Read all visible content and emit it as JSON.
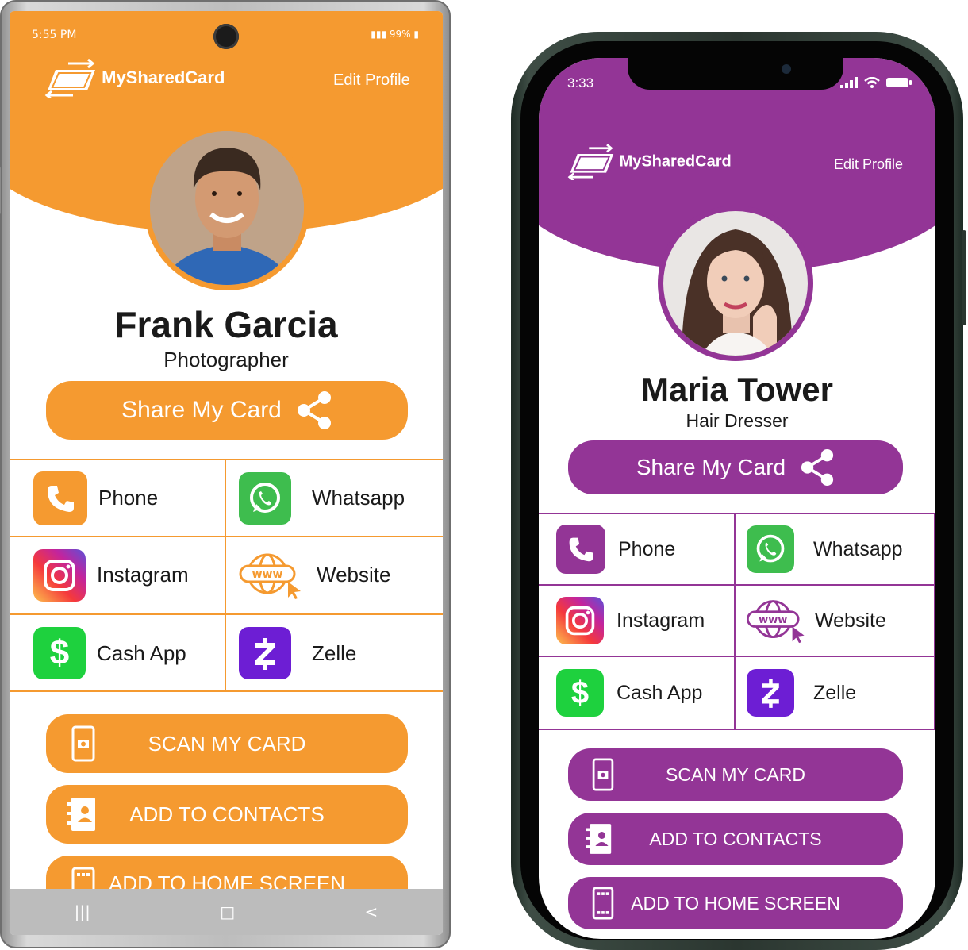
{
  "colors": {
    "android_accent": "#f59a30",
    "iphone_accent": "#933596",
    "whatsapp": "#3ebd4e",
    "cashapp": "#1ed13e",
    "zelle": "#6d1ed4"
  },
  "android": {
    "status": {
      "time": "5:55 PM",
      "battery": "99%"
    },
    "brand": "MySharedCard",
    "edit_profile": "Edit Profile",
    "name": "Frank Garcia",
    "title": "Photographer",
    "share_label": "Share My Card",
    "links": [
      {
        "label": "Phone",
        "icon": "phone-icon"
      },
      {
        "label": "Whatsapp",
        "icon": "whatsapp-icon"
      },
      {
        "label": "Instagram",
        "icon": "instagram-icon"
      },
      {
        "label": "Website",
        "icon": "website-icon"
      },
      {
        "label": "Cash App",
        "icon": "cashapp-icon"
      },
      {
        "label": "Zelle",
        "icon": "zelle-icon"
      }
    ],
    "actions": [
      "SCAN MY CARD",
      "ADD TO CONTACTS",
      "ADD TO HOME SCREEN"
    ],
    "nav": [
      "|||",
      "□",
      "<"
    ]
  },
  "iphone": {
    "status": {
      "time": "3:33"
    },
    "brand": "MySharedCard",
    "edit_profile": "Edit Profile",
    "name": "Maria Tower",
    "title": "Hair Dresser",
    "share_label": "Share My Card",
    "links": [
      {
        "label": "Phone",
        "icon": "phone-icon"
      },
      {
        "label": "Whatsapp",
        "icon": "whatsapp-icon"
      },
      {
        "label": "Instagram",
        "icon": "instagram-icon"
      },
      {
        "label": "Website",
        "icon": "website-icon"
      },
      {
        "label": "Cash App",
        "icon": "cashapp-icon"
      },
      {
        "label": "Zelle",
        "icon": "zelle-icon"
      }
    ],
    "actions": [
      "SCAN MY CARD",
      "ADD TO CONTACTS",
      "ADD TO HOME SCREEN"
    ]
  }
}
